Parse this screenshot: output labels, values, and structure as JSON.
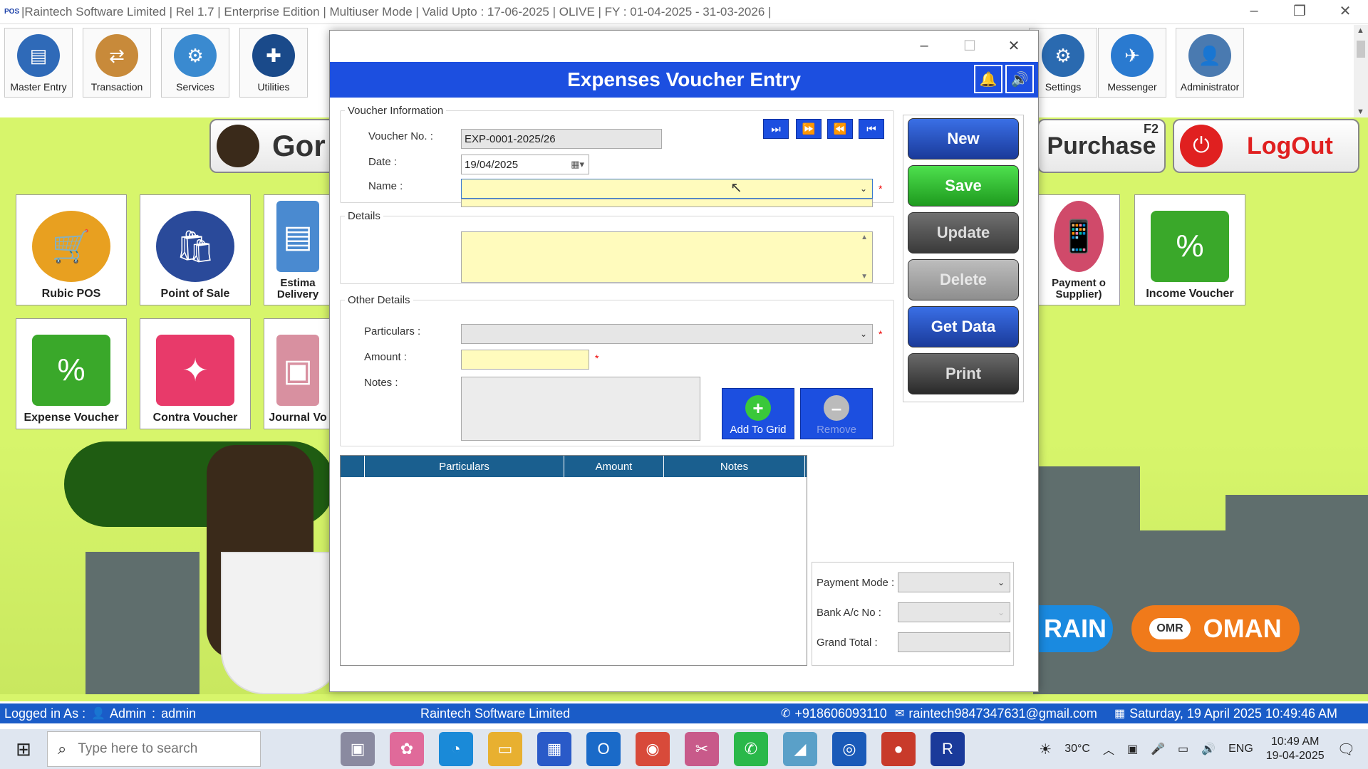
{
  "window": {
    "app_logo": "POS",
    "title": "|Raintech Software Limited | Rel 1.7 | Enterprise Edition | Multiuser Mode | Valid Upto : 17-06-2025 | OLIVE | FY : 01-04-2025 - 31-03-2026 |"
  },
  "toolbar": {
    "items": [
      {
        "label": "Master Entry",
        "icon": "master-entry-icon"
      },
      {
        "label": "Transaction",
        "icon": "transaction-icon"
      },
      {
        "label": "Services",
        "icon": "services-icon"
      },
      {
        "label": "Utilities",
        "icon": "utilities-icon"
      },
      {
        "label": "Settings",
        "icon": "settings-icon"
      },
      {
        "label": "Messenger",
        "icon": "messenger-icon"
      },
      {
        "label": "Administrator",
        "icon": "administrator-icon"
      }
    ]
  },
  "dashboard": {
    "go_label": "Gor",
    "purchase_label": "Purchase",
    "purchase_key": "F2",
    "logout_label": "LogOut",
    "cards": [
      {
        "label": "Rubic POS"
      },
      {
        "label": "Point of Sale"
      },
      {
        "label": "Estima Delivery"
      },
      {
        "label": "Payment o Supplier)"
      },
      {
        "label": "Income Voucher"
      },
      {
        "label": "Expense Voucher"
      },
      {
        "label": "Contra Voucher"
      },
      {
        "label": "Journal Vo"
      }
    ],
    "bahrain_label": "RAIN",
    "oman_label": "OMAN",
    "omr_label": "OMR"
  },
  "modal": {
    "title": "Expenses Voucher Entry",
    "voucher_info_legend": "Voucher Information",
    "voucher_no_label": "Voucher No. :",
    "voucher_no_value": "EXP-0001-2025/26",
    "date_label": "Date :",
    "date_value": "19/04/2025",
    "name_label": "Name :",
    "name_value": "",
    "details_legend": "Details",
    "details_value": "",
    "other_details_legend": "Other Details",
    "particulars_label": "Particulars :",
    "particulars_value": "",
    "amount_label": "Amount :",
    "amount_value": "",
    "notes_label": "Notes :",
    "notes_value": "",
    "required_mark": "*",
    "add_to_grid_label": "Add To Grid",
    "remove_label": "Remove",
    "grid_columns": [
      "",
      "Particulars",
      "Amount",
      "Notes"
    ],
    "payment_mode_label": "Payment Mode :",
    "payment_mode_value": "",
    "bank_ac_label": "Bank A/c No :",
    "bank_ac_value": "",
    "grand_total_label": "Grand Total :",
    "grand_total_value": "",
    "actions": {
      "new": "New",
      "save": "Save",
      "update": "Update",
      "delete": "Delete",
      "get_data": "Get Data",
      "print": "Print"
    }
  },
  "statusbar": {
    "logged_in_label": "Logged in As :",
    "user": "Admin",
    "user_sep": ":",
    "user_id": "admin",
    "company": "Raintech Software Limited",
    "phone": "+918606093110",
    "email": "raintech9847347631@gmail.com",
    "datetime": "Saturday, 19 April 2025 10:49:46 AM"
  },
  "taskbar": {
    "search_placeholder": "Type here to search",
    "temperature": "30°C",
    "language": "ENG",
    "time": "10:49 AM",
    "date": "19-04-2025"
  },
  "colors": {
    "header_blue": "#1c4fe0",
    "dashboard_bg": "#d7f56b",
    "input_yellow": "#fffbbd",
    "status_blue": "#1a5cc8"
  }
}
